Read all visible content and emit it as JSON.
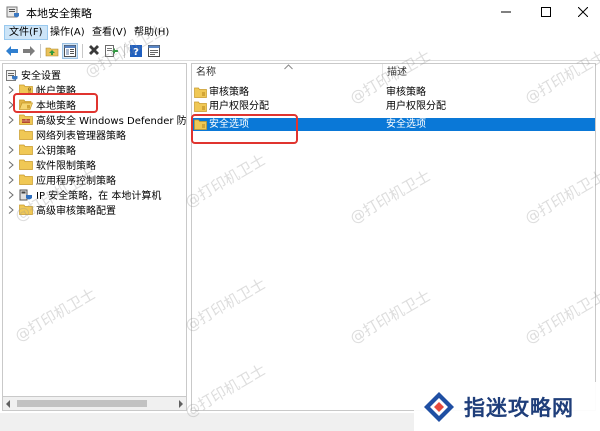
{
  "window": {
    "title": "本地安全策略",
    "controls": [
      "minimize",
      "maximize",
      "close"
    ]
  },
  "menu": {
    "items": [
      {
        "label": "文件(F)",
        "active": true
      },
      {
        "label": "操作(A)",
        "active": false
      },
      {
        "label": "查看(V)",
        "active": false
      },
      {
        "label": "帮助(H)",
        "active": false
      }
    ]
  },
  "toolbar": {
    "buttons": [
      "back-icon",
      "forward-icon",
      "up-folder-icon",
      "show-hide-tree-icon",
      "delete-icon",
      "export-list-icon",
      "help-icon",
      "properties-icon"
    ]
  },
  "tree": {
    "root": "安全设置",
    "items": [
      {
        "label": "帐户策略",
        "icon": "folder-icon",
        "expandable": true
      },
      {
        "label": "本地策略",
        "icon": "folder-open-icon",
        "expandable": true
      },
      {
        "label": "高级安全 Windows Defender 防火墙",
        "icon": "firewall-icon",
        "expandable": true
      },
      {
        "label": "网络列表管理器策略",
        "icon": "folder-icon",
        "expandable": false
      },
      {
        "label": "公钥策略",
        "icon": "folder-icon",
        "expandable": true
      },
      {
        "label": "软件限制策略",
        "icon": "folder-icon",
        "expandable": true
      },
      {
        "label": "应用程序控制策略",
        "icon": "folder-icon",
        "expandable": true
      },
      {
        "label": "IP 安全策略，在 本地计算机",
        "icon": "ip-security-icon",
        "expandable": true
      },
      {
        "label": "高级审核策略配置",
        "icon": "folder-icon",
        "expandable": true
      }
    ]
  },
  "list": {
    "columns": [
      "名称",
      "描述"
    ],
    "rows": [
      {
        "name": "审核策略",
        "desc": "审核策略",
        "selected": false
      },
      {
        "name": "用户权限分配",
        "desc": "用户权限分配",
        "selected": false
      },
      {
        "name": "安全选项",
        "desc": "安全选项",
        "selected": true
      }
    ]
  },
  "watermarks": [
    "@打印机卫士",
    "@打印机卫士",
    "@打印机卫士",
    "@打印机卫士",
    "@打印机卫士",
    "@打印机卫士",
    "@打印机卫士",
    "@打印机卫士",
    "@打印机卫士",
    "@打印机卫士",
    "@打印机卫士",
    "@打印机卫士"
  ],
  "brand": {
    "text": "指迷攻略网"
  },
  "colors": {
    "selection": "#0a78d7",
    "annotation": "#e0342f",
    "brand": "#1f3e7a"
  }
}
